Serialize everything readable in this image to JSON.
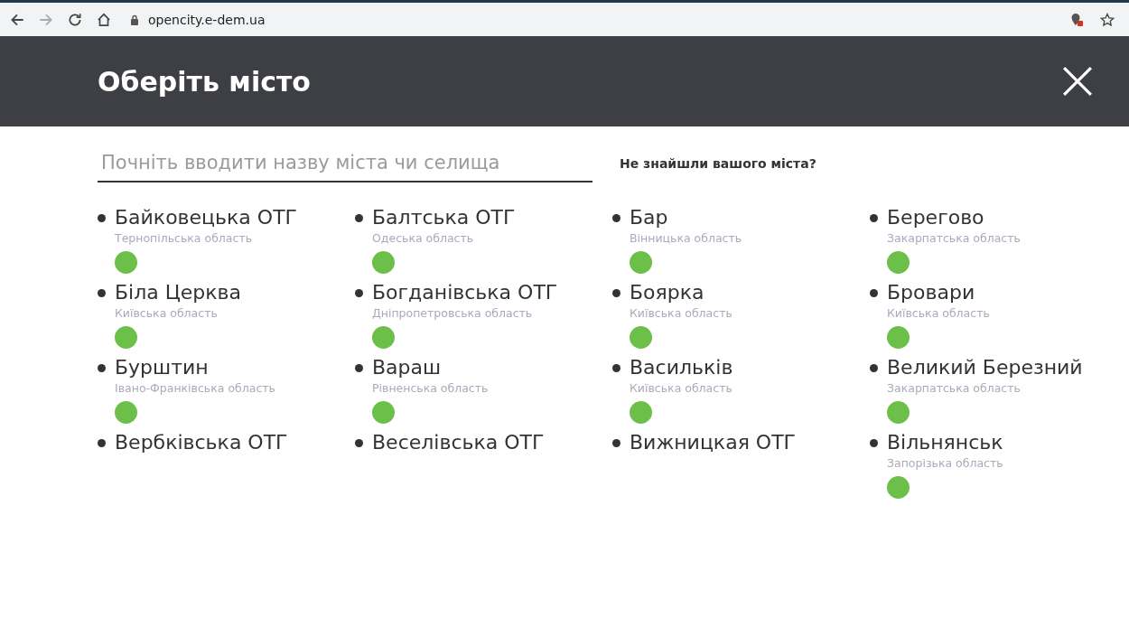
{
  "browser": {
    "url": "opencity.e-dem.ua",
    "forward_disabled": true
  },
  "header": {
    "title": "Оберіть місто"
  },
  "search": {
    "placeholder": "Почніть вводити назву міста чи селища"
  },
  "not_found_link": "Не знайшли вашого міста?",
  "cities": [
    {
      "name": "Байковецька ОТГ",
      "region": "Тернопільська область",
      "color": "#6cc04a"
    },
    {
      "name": "Балтська ОТГ",
      "region": "Одеська область",
      "color": "#6cc04a"
    },
    {
      "name": "Бар",
      "region": "Вінницька область",
      "color": "#6cc04a"
    },
    {
      "name": "Берегово",
      "region": "Закарпатська область",
      "color": "#6cc04a"
    },
    {
      "name": "Біла Церква",
      "region": "Київська область",
      "color": "#6cc04a"
    },
    {
      "name": "Богданівська ОТГ",
      "region": "Дніпропетровська область",
      "color": "#6cc04a"
    },
    {
      "name": "Боярка",
      "region": "Київська область",
      "color": "#6cc04a"
    },
    {
      "name": "Бровари",
      "region": "Київська область",
      "color": "#6cc04a"
    },
    {
      "name": "Бурштин",
      "region": "Івано-Франківська область",
      "color": "#6cc04a"
    },
    {
      "name": "Вараш",
      "region": "Рівненська область",
      "color": "#6cc04a"
    },
    {
      "name": "Васильків",
      "region": "Київська область",
      "color": "#6cc04a"
    },
    {
      "name": "Великий Березний",
      "region": "Закарпатська область",
      "color": "#6cc04a"
    },
    {
      "name": "Вербківська ОТГ"
    },
    {
      "name": "Веселівська ОТГ"
    },
    {
      "name": "Вижницкая ОТГ"
    },
    {
      "name": "Вільнянськ",
      "region": "Запорізька область",
      "color": "#6cc04a"
    }
  ]
}
